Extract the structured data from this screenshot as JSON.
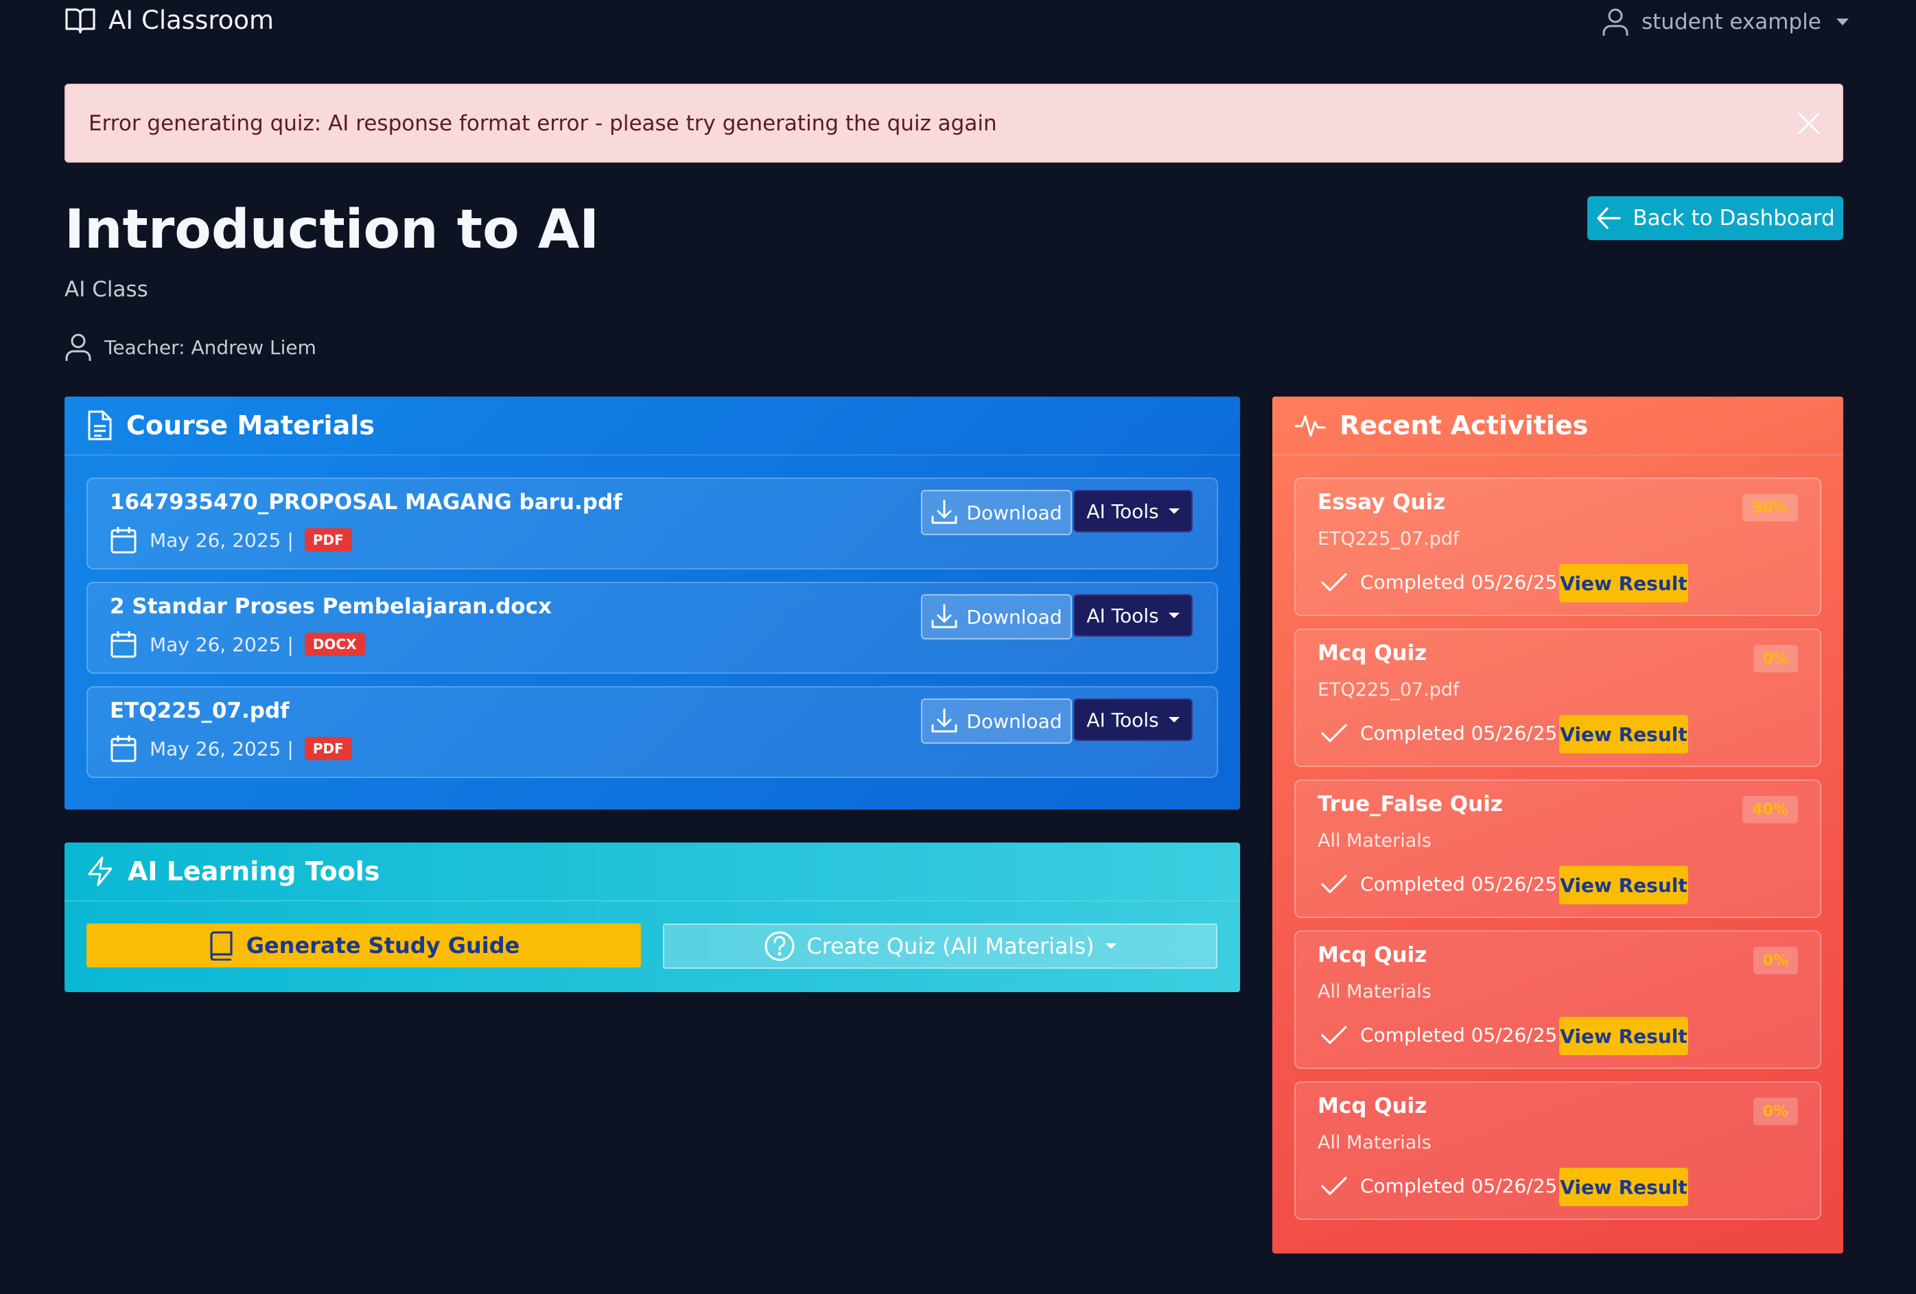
{
  "navbar": {
    "brand": "AI Classroom",
    "brand_icon": "book-open-icon",
    "user_name": "student example",
    "user_icon": "user-icon"
  },
  "alert": {
    "message": "Error generating quiz: AI response format error - please try generating the quiz again",
    "close_icon": "close-icon"
  },
  "course": {
    "title": "Introduction to AI",
    "class_name": "AI Class",
    "teacher": "Teacher: Andrew Liem",
    "back_label": "Back to Dashboard"
  },
  "materials": {
    "title": "Course Materials",
    "download_label": "Download",
    "ai_tools_label": "AI Tools",
    "items": [
      {
        "name": "1647935470_PROPOSAL MAGANG baru.pdf",
        "date": "May 26, 2025 |",
        "type": "PDF"
      },
      {
        "name": "2 Standar Proses Pembelajaran.docx",
        "date": "May 26, 2025 |",
        "type": "DOCX"
      },
      {
        "name": "ETQ225_07.pdf",
        "date": "May 26, 2025 |",
        "type": "PDF"
      }
    ]
  },
  "tools": {
    "title": "AI Learning Tools",
    "study_guide_label": "Generate Study Guide",
    "quiz_label": "Create Quiz (All Materials)"
  },
  "activities": {
    "title": "Recent Activities",
    "view_label": "View Result",
    "items": [
      {
        "title": "Essay Quiz",
        "source": "ETQ225_07.pdf",
        "status": "Completed 05/26/25",
        "score": "50%"
      },
      {
        "title": "Mcq Quiz",
        "source": "ETQ225_07.pdf",
        "status": "Completed 05/26/25",
        "score": "0%"
      },
      {
        "title": "True_False Quiz",
        "source": "All Materials",
        "status": "Completed 05/26/25",
        "score": "40%"
      },
      {
        "title": "Mcq Quiz",
        "source": "All Materials",
        "status": "Completed 05/26/25",
        "score": "0%"
      },
      {
        "title": "Mcq Quiz",
        "source": "All Materials",
        "status": "Completed 05/26/25",
        "score": "0%"
      }
    ]
  },
  "colors": {
    "background": "#0d1322",
    "alert_bg": "#f8d9dc",
    "primary_blue": "#1486e8",
    "cyan": "#0aa6c8",
    "accent_yellow": "#fbbc05",
    "activities_red": "#f5574c",
    "badge_red": "#e53935",
    "ai_tools_navy": "#1c1d5e"
  }
}
